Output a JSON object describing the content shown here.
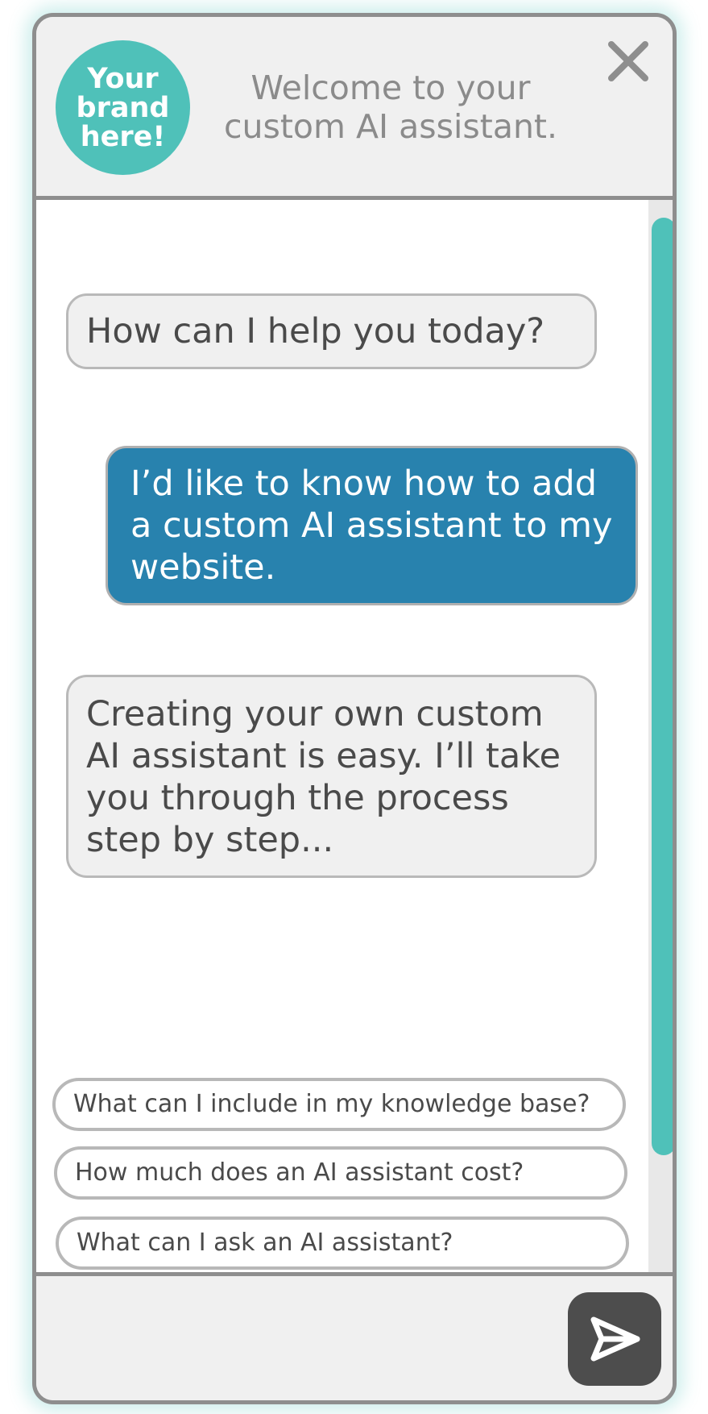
{
  "header": {
    "brand_logo_text": "Your brand here!",
    "brand_logo_lines": [
      "Your",
      "brand",
      "here!"
    ],
    "welcome_line1": "Welcome to your",
    "welcome_line2": "custom AI assistant."
  },
  "messages": [
    {
      "role": "assistant",
      "text": "How can I help you today?"
    },
    {
      "role": "user",
      "text": "I’d like to know how to add a custom AI assistant to my website."
    },
    {
      "role": "assistant",
      "text": "Creating your own custom AI assistant is easy. I’ll take you through the process step by step..."
    }
  ],
  "suggestions": [
    "What can I include in my knowledge base?",
    "How much does an AI assistant cost?",
    "What can I ask an AI assistant?"
  ],
  "icons": {
    "close": "close-icon",
    "send": "send-icon"
  },
  "colors": {
    "accent": "#4fc1b9",
    "user_bubble": "#2882ae",
    "send_button": "#4d4d4d",
    "border": "#8e8e8e"
  }
}
